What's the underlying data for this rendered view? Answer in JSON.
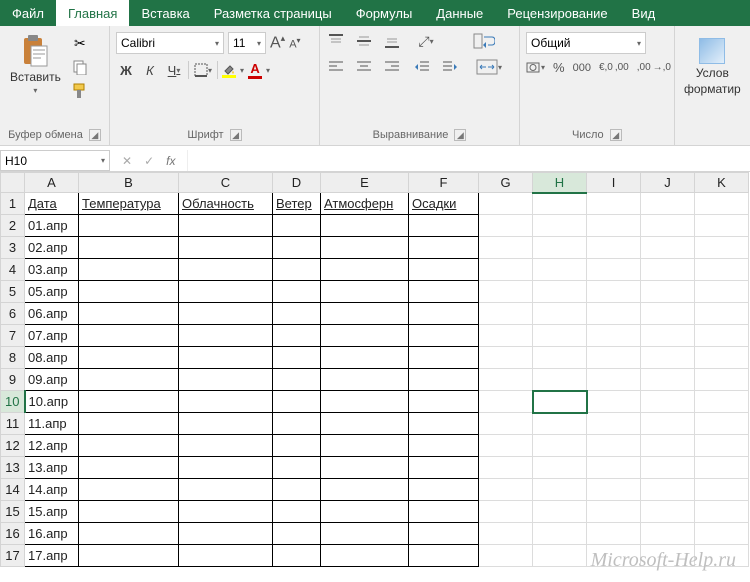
{
  "tabs": {
    "file": "Файл",
    "home": "Главная",
    "insert": "Вставка",
    "layout": "Разметка страницы",
    "formulas": "Формулы",
    "data": "Данные",
    "review": "Рецензирование",
    "view": "Вид"
  },
  "clipboard": {
    "paste": "Вставить",
    "label": "Буфер обмена"
  },
  "font": {
    "name": "Calibri",
    "size": "11",
    "label": "Шрифт",
    "bold": "Ж",
    "italic": "К",
    "under": "Ч"
  },
  "align": {
    "label": "Выравнивание"
  },
  "number": {
    "format": "Общий",
    "label": "Число"
  },
  "styles": {
    "cond1": "Услов",
    "cond2": "форматир"
  },
  "fx": {
    "namebox": "H10"
  },
  "grid": {
    "cols": [
      "A",
      "B",
      "C",
      "D",
      "E",
      "F",
      "G",
      "H",
      "I",
      "J",
      "K"
    ],
    "widths": [
      54,
      100,
      94,
      48,
      88,
      70,
      54,
      54,
      54,
      54,
      54
    ],
    "selectedCol": 7,
    "selectedRow": 10,
    "rows": 17,
    "headerRow": [
      "Дата",
      "Температура",
      "Облачность",
      "Ветер",
      "Атмосферн",
      "Осадки"
    ],
    "dateCol": [
      "01.апр",
      "02.апр",
      "03.апр",
      "05.апр",
      "06.апр",
      "07.апр",
      "08.апр",
      "09.апр",
      "10.апр",
      "11.апр",
      "12.апр",
      "13.апр",
      "14.апр",
      "15.апр",
      "16.апр",
      "17.апр"
    ],
    "borderedCols": 6,
    "activeCell": {
      "r": 10,
      "c": 8
    }
  },
  "watermark": "Microsoft-Help.ru"
}
